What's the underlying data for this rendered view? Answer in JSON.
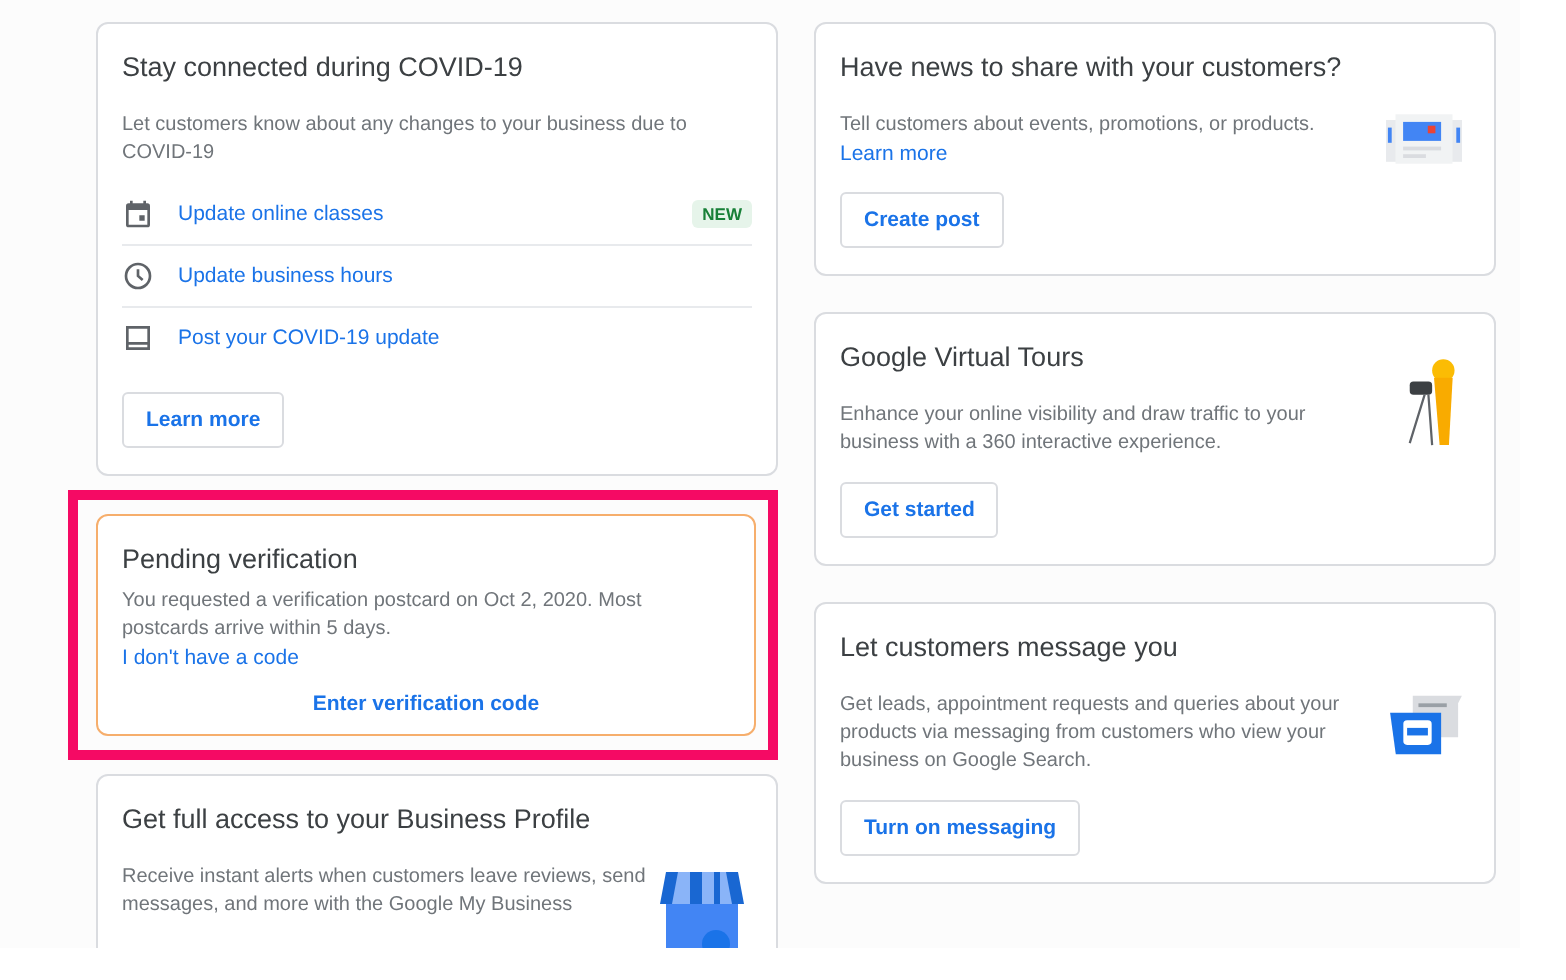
{
  "columns": [
    {
      "cards": [
        {
          "kind": "links",
          "title": "Stay connected during COVID-19",
          "description": "Let customers know about any changes to your business due to COVID-19",
          "links": [
            {
              "label": "Update online classes",
              "badge": "NEW"
            },
            {
              "label": "Update business hours"
            },
            {
              "label": "Post your COVID-19 update"
            }
          ],
          "button": "Learn more"
        },
        {
          "kind": "verification",
          "highlighted": true,
          "title": "Pending verification",
          "description": "You requested a verification postcard on Oct 2, 2020. Most postcards arrive within 5 days.",
          "link": "I don't have a code",
          "action": "Enter verification code"
        },
        {
          "kind": "store",
          "title": "Get full access to your Business Profile",
          "description": "Receive instant alerts when customers leave reviews, send messages, and more with the Google My Business"
        }
      ]
    },
    {
      "cards": [
        {
          "kind": "news",
          "title": "Have news to share with your customers?",
          "description": "Tell customers about events, promotions, or products.",
          "link": "Learn more",
          "button": "Create post"
        },
        {
          "kind": "tour",
          "title": "Google Virtual Tours",
          "description": "Enhance your online visibility and draw traffic to your business with a 360 interactive experience.",
          "button": "Get started"
        },
        {
          "kind": "messaging",
          "title": "Let customers message you",
          "description": "Get leads, appointment requests and queries about your products via messaging from customers who view your business on Google Search.",
          "button": "Turn on messaging"
        }
      ]
    }
  ]
}
